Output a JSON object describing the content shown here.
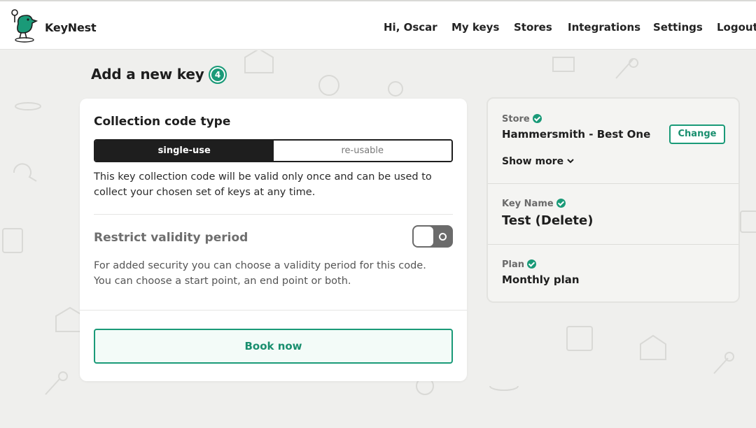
{
  "brand": {
    "name": "KeyNest",
    "logo_icon": "bird-key-logo-icon",
    "accent": "#1a9a78"
  },
  "nav": {
    "greeting": "Hi, Oscar",
    "items": [
      {
        "label": "My keys"
      },
      {
        "label": "Stores"
      },
      {
        "label": "Integrations"
      },
      {
        "label": "Settings"
      },
      {
        "label": "Logout"
      }
    ]
  },
  "page": {
    "title": "Add a new key",
    "step": "4"
  },
  "collection": {
    "heading": "Collection code type",
    "options": [
      "single-use",
      "re-usable"
    ],
    "selected": "single-use",
    "description": "This key collection code will be valid only once and can be used to collect your chosen set of keys at any time."
  },
  "restrict": {
    "heading": "Restrict validity period",
    "enabled": false,
    "description_line1": "For added security you can choose a validity period for this code.",
    "description_line2": "You can choose a start point, an end point or both."
  },
  "actions": {
    "book_label": "Book now"
  },
  "summary": {
    "store": {
      "label": "Store",
      "value": "Hammersmith - Best One",
      "change_label": "Change",
      "show_more_label": "Show more"
    },
    "key_name": {
      "label": "Key Name",
      "value": "Test (Delete)"
    },
    "plan": {
      "label": "Plan",
      "value": "Monthly plan"
    }
  }
}
